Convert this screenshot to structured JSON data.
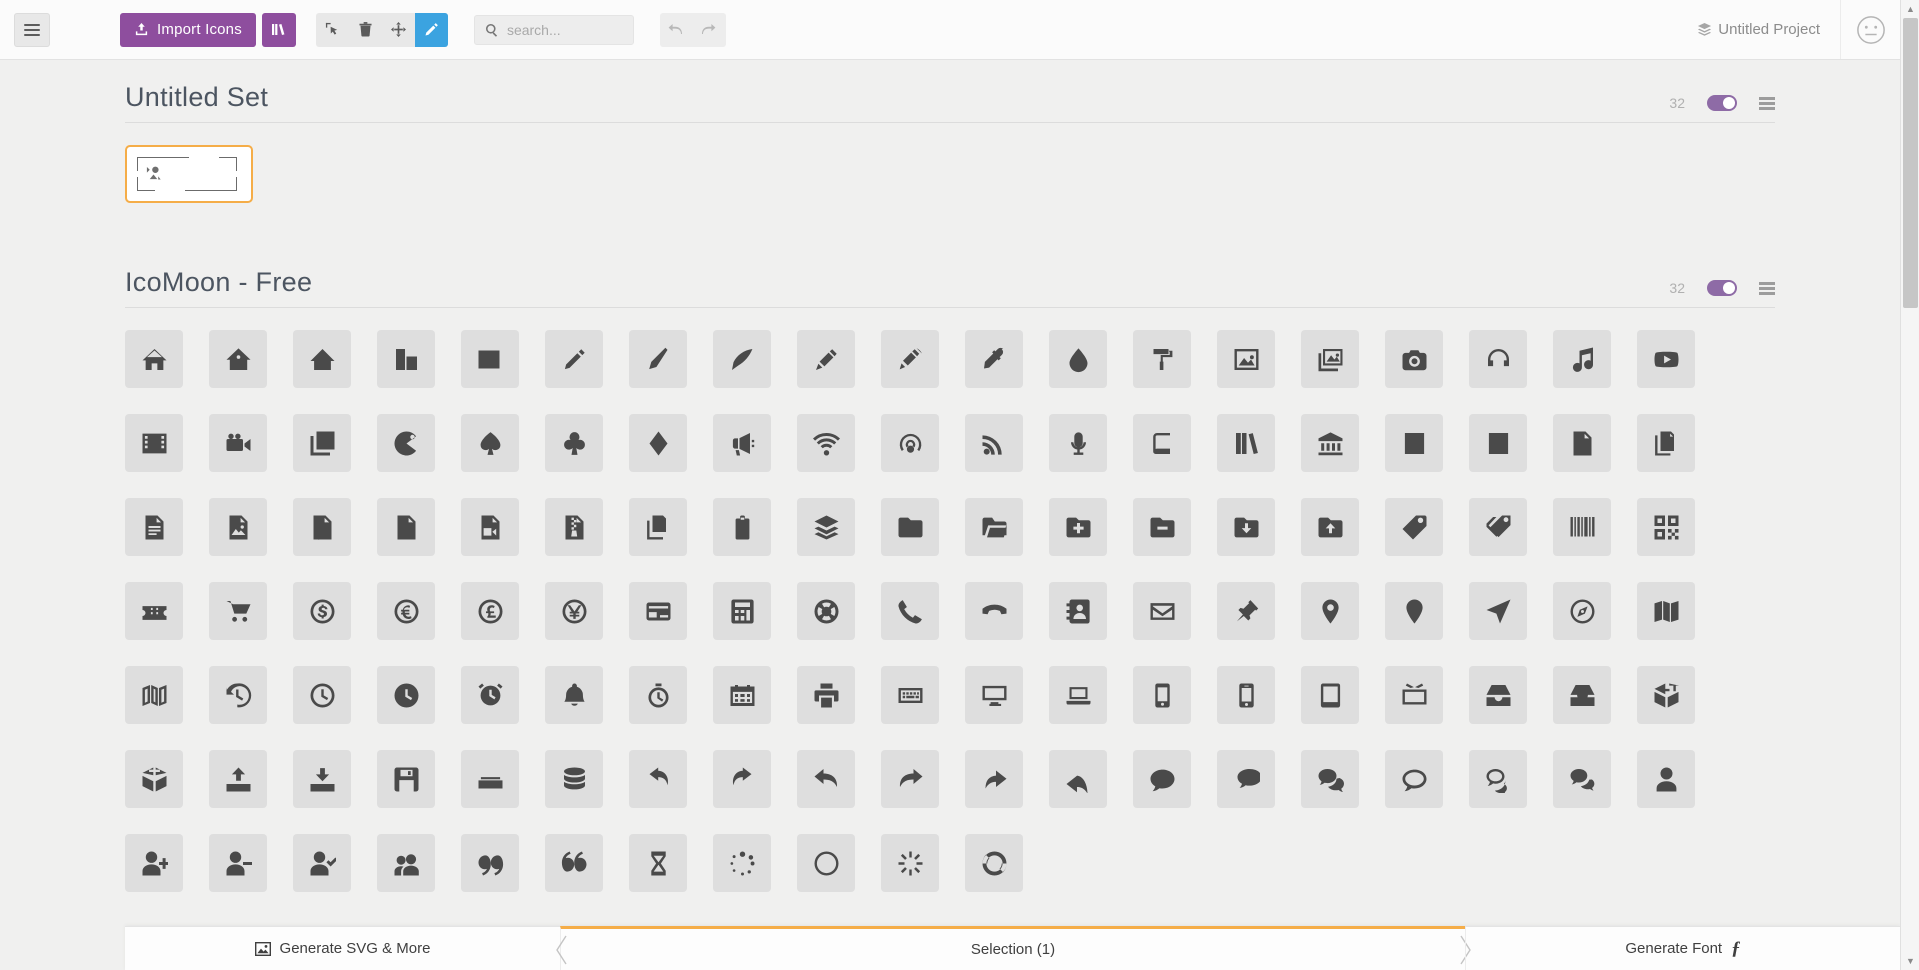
{
  "header": {
    "menu_icon": "hamburger-icon",
    "import_label": "Import Icons",
    "library_icon": "library-icon",
    "tools": [
      {
        "name": "select-tool",
        "icon": "cursor-icon",
        "active": false
      },
      {
        "name": "delete-tool",
        "icon": "trash-icon",
        "active": false
      },
      {
        "name": "move-tool",
        "icon": "move-icon",
        "active": false
      },
      {
        "name": "edit-tool",
        "icon": "pencil-icon",
        "active": true
      }
    ],
    "search": {
      "placeholder": "search...",
      "value": "",
      "icon": "search-icon"
    },
    "undo_icon": "undo-arrow-icon",
    "redo_icon": "redo-arrow-icon",
    "project_name": "Untitled Project",
    "project_icon": "layers-icon",
    "avatar_icon": "neutral-face-icon",
    "accent_purple": "#8e4e9e",
    "accent_blue": "#3ba3e0"
  },
  "sets": [
    {
      "title": "Untitled Set",
      "count": "32",
      "toggle_on": true,
      "menu_icon": "list-menu-icon",
      "selected_tile_icon": "image-placeholder-icon"
    },
    {
      "title": "IcoMoon - Free",
      "count": "32",
      "toggle_on": true,
      "menu_icon": "list-menu-icon"
    }
  ],
  "icons": [
    "home",
    "home2",
    "home3",
    "office",
    "newspaper",
    "pencil",
    "pencil2",
    "quill",
    "pen",
    "blog",
    "eyedropper",
    "droplet",
    "paint-format",
    "image",
    "images",
    "camera",
    "headphones",
    "music",
    "play",
    "film",
    "video-camera",
    "dice",
    "pacman",
    "spades",
    "clubs",
    "diamonds",
    "bullhorn",
    "connection",
    "podcast",
    "feed",
    "mic",
    "book",
    "books",
    "library",
    "file-text",
    "profile",
    "file-empty",
    "files-empty",
    "file-text2",
    "file-picture",
    "file-music",
    "file-play",
    "file-video",
    "file-zip",
    "copy",
    "paste",
    "stack",
    "folder",
    "folder-open",
    "folder-plus",
    "folder-minus",
    "folder-download",
    "folder-upload",
    "price-tag",
    "price-tags",
    "barcode",
    "qrcode",
    "ticket",
    "cart",
    "coin-dollar",
    "coin-euro",
    "coin-pound",
    "coin-yen",
    "credit-card",
    "calculator",
    "lifebuoy",
    "phone",
    "phone-hang-up",
    "address-book",
    "envelop",
    "pushpin",
    "location",
    "location2",
    "compass",
    "compass2",
    "map",
    "map2",
    "history",
    "clock",
    "clock2",
    "alarm",
    "bell",
    "stopwatch",
    "calendar",
    "printer",
    "keyboard",
    "display",
    "laptop",
    "mobile",
    "mobile2",
    "tablet",
    "tv",
    "drawer",
    "drawer2",
    "box-add",
    "box-remove",
    "download",
    "upload",
    "floppy-disk",
    "drive",
    "database",
    "undo",
    "redo",
    "undo2",
    "redo2",
    "forward",
    "reply",
    "bubble",
    "bubbles",
    "bubbles2",
    "bubble2",
    "bubbles3",
    "bubbles4",
    "user",
    "user-plus",
    "user-minus",
    "user-check",
    "users",
    "quotes-left",
    "quotes-right",
    "hour-glass",
    "spinner",
    "spinner2",
    "spinner3",
    "spinner4"
  ],
  "bottom_bar": {
    "generate_svg_label": "Generate SVG & More",
    "generate_svg_icon": "image-icon",
    "selection_label": "Selection (1)",
    "prev_icon": "chevron-left-icon",
    "next_icon": "chevron-right-icon",
    "generate_font_label": "Generate Font",
    "generate_font_icon": "font-f-icon",
    "active_accent": "#f5ad48"
  },
  "scrollbar": {
    "up_icon": "triangle-up-icon",
    "down_icon": "triangle-down-icon"
  }
}
